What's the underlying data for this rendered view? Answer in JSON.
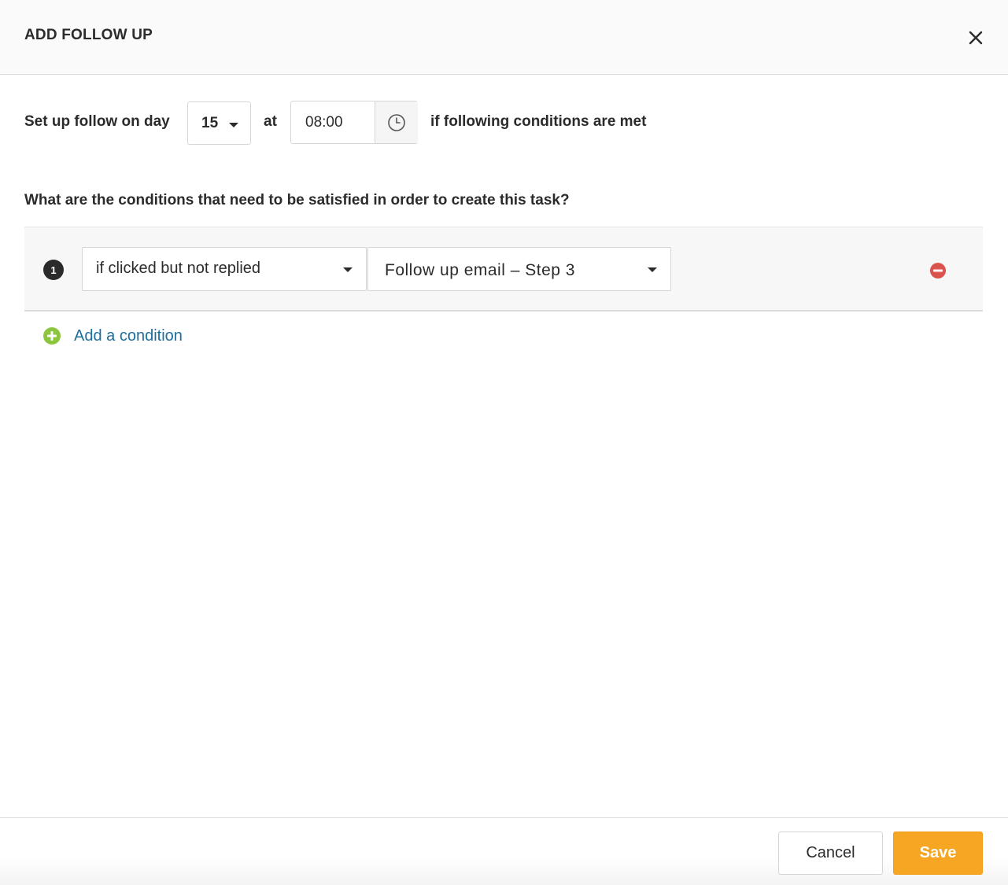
{
  "header": {
    "title": "ADD FOLLOW UP",
    "close_icon": "close-icon"
  },
  "schedule": {
    "prefix_label": "Set up follow on day",
    "day_value": "15",
    "at_label": "at",
    "time_value": "08:00",
    "clock_icon": "clock-icon",
    "suffix_label": "if following conditions are met"
  },
  "conditions": {
    "question": "What are the conditions that need to be satisfied in order to create this task?",
    "items": [
      {
        "number": "1",
        "type_value": "if clicked but not replied",
        "step_value": "Follow up email – Step 3",
        "remove_icon": "remove-circle-icon"
      }
    ],
    "add_label": "Add a condition",
    "add_icon": "add-circle-icon"
  },
  "footer": {
    "cancel_label": "Cancel",
    "save_label": "Save"
  },
  "colors": {
    "accent_link": "#1c6e9c",
    "save_button": "#f6a623",
    "add_icon": "#8cc63f",
    "remove_icon": "#d9534f"
  }
}
